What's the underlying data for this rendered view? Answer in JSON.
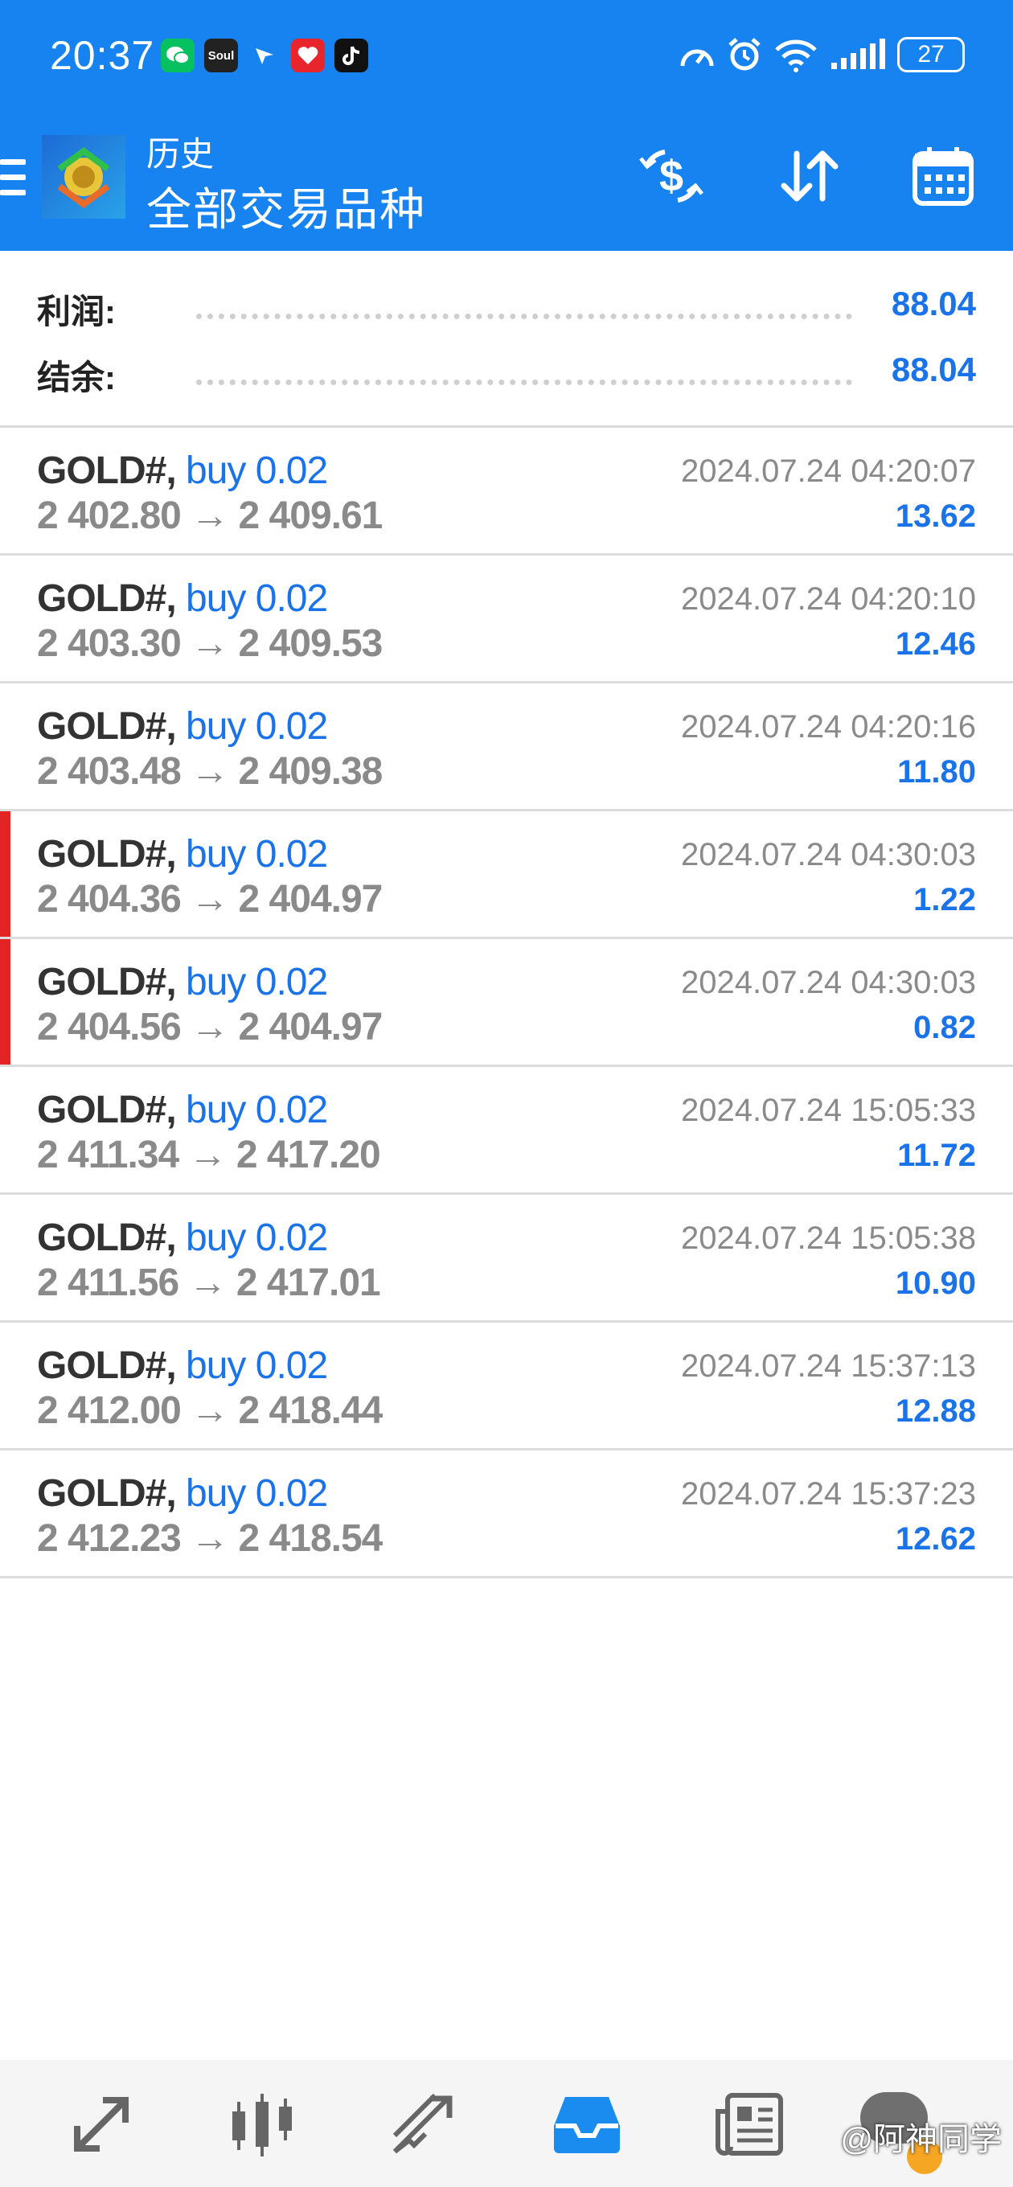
{
  "status_bar": {
    "time": "20:37",
    "battery": "27",
    "app_icons": [
      "wechat-icon",
      "soul-icon",
      "feishu-icon",
      "heart-app-icon",
      "tiktok-icon"
    ],
    "app_labels": {
      "soul": "Soul"
    },
    "system_icons": [
      "speedometer-icon",
      "alarm-icon",
      "wifi-6-icon",
      "cellular-signal-icon",
      "battery-icon"
    ]
  },
  "header": {
    "subtitle": "历史",
    "title": "全部交易品种",
    "actions": [
      "currency-exchange-icon",
      "sort-icon",
      "calendar-icon"
    ]
  },
  "summary": {
    "profit_label": "利润:",
    "profit_value": "88.04",
    "balance_label": "结余:",
    "balance_value": "88.04"
  },
  "deals": [
    {
      "symbol": "GOLD#,",
      "side": "buy 0.02",
      "prices": "2 402.80 → 2 409.61",
      "time": "2024.07.24 04:20:07",
      "profit": "13.62",
      "flag": false
    },
    {
      "symbol": "GOLD#,",
      "side": "buy 0.02",
      "prices": "2 403.30 → 2 409.53",
      "time": "2024.07.24 04:20:10",
      "profit": "12.46",
      "flag": false
    },
    {
      "symbol": "GOLD#,",
      "side": "buy 0.02",
      "prices": "2 403.48 → 2 409.38",
      "time": "2024.07.24 04:20:16",
      "profit": "11.80",
      "flag": false
    },
    {
      "symbol": "GOLD#,",
      "side": "buy 0.02",
      "prices": "2 404.36 → 2 404.97",
      "time": "2024.07.24 04:30:03",
      "profit": "1.22",
      "flag": true
    },
    {
      "symbol": "GOLD#,",
      "side": "buy 0.02",
      "prices": "2 404.56 → 2 404.97",
      "time": "2024.07.24 04:30:03",
      "profit": "0.82",
      "flag": true
    },
    {
      "symbol": "GOLD#,",
      "side": "buy 0.02",
      "prices": "2 411.34 → 2 417.20",
      "time": "2024.07.24 15:05:33",
      "profit": "11.72",
      "flag": false
    },
    {
      "symbol": "GOLD#,",
      "side": "buy 0.02",
      "prices": "2 411.56 → 2 417.01",
      "time": "2024.07.24 15:05:38",
      "profit": "10.90",
      "flag": false
    },
    {
      "symbol": "GOLD#,",
      "side": "buy 0.02",
      "prices": "2 412.00 → 2 418.44",
      "time": "2024.07.24 15:37:13",
      "profit": "12.88",
      "flag": false
    },
    {
      "symbol": "GOLD#,",
      "side": "buy 0.02",
      "prices": "2 412.23 → 2 418.54",
      "time": "2024.07.24 15:37:23",
      "profit": "12.62",
      "flag": false
    }
  ],
  "bottom_nav": {
    "items": [
      "quotes-icon",
      "chart-candles-icon",
      "trade-icon",
      "history-inbox-icon",
      "news-icon",
      "chat-icon"
    ],
    "active": "history-inbox-icon",
    "active_color": "#1a8cf0"
  },
  "watermark": "@阿神同学",
  "colors": {
    "header_bg": "#1683f1",
    "accent": "#1a73e8",
    "flag": "#e32424"
  }
}
